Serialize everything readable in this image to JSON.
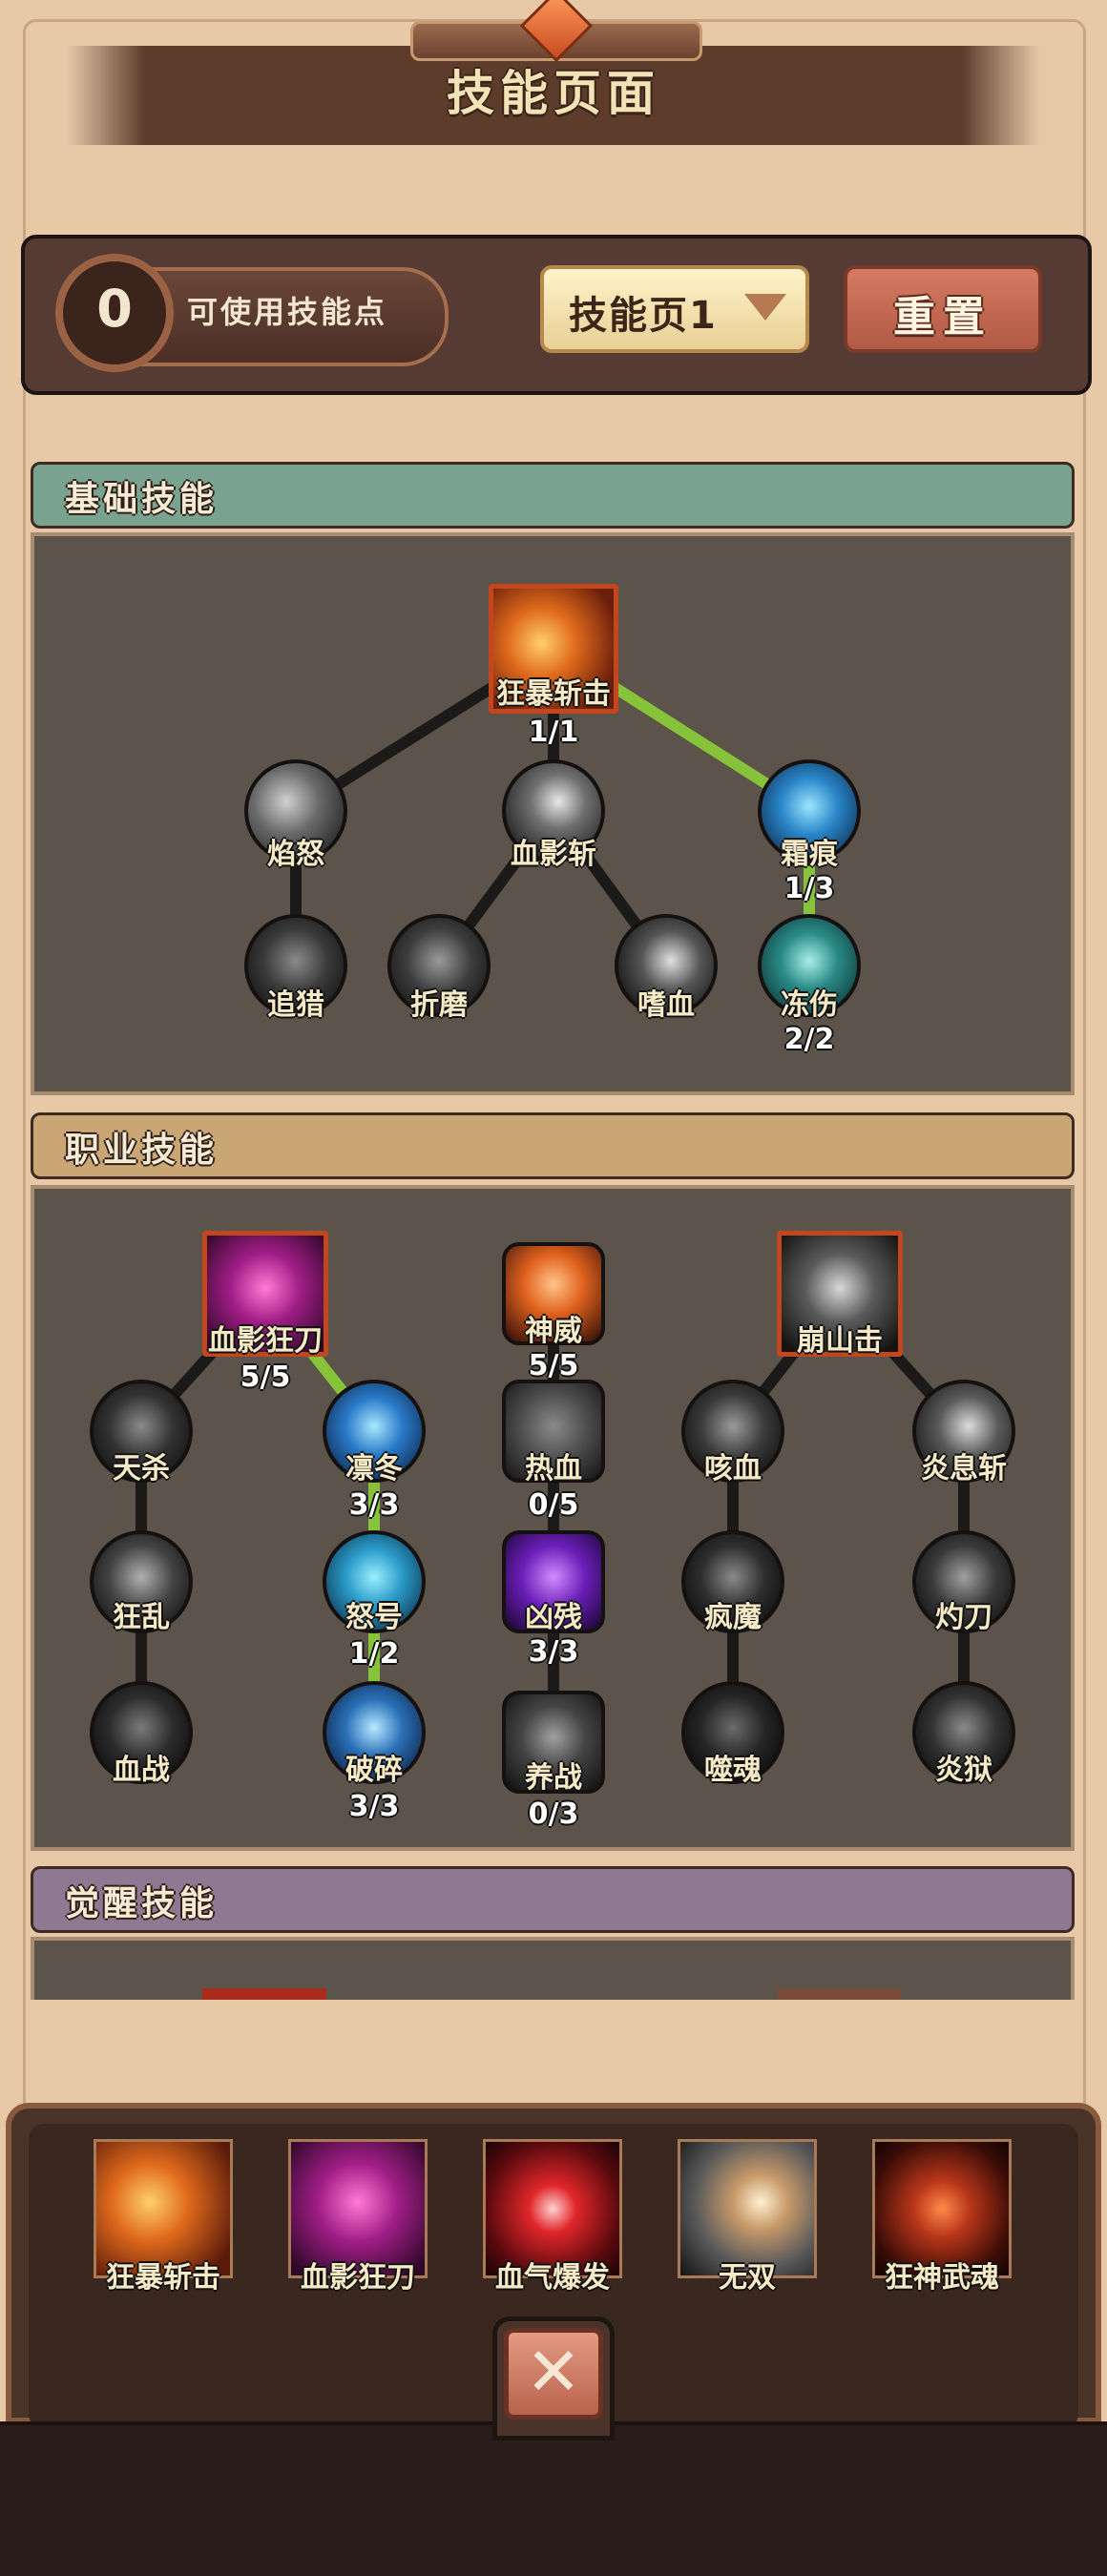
{
  "header": {
    "title": "技能页面"
  },
  "toolbar": {
    "skill_points": "0",
    "skill_points_label": "可使用技能点",
    "page_selector": "技能页1",
    "reset_label": "重置"
  },
  "sections": {
    "basic": {
      "title": "基础技能"
    },
    "class": {
      "title": "职业技能"
    },
    "awaken": {
      "title": "觉醒技能"
    }
  },
  "basic_skills": {
    "kuangbao": {
      "name": "狂暴斩击",
      "level": "1/1",
      "icon": "axe-slash-icon"
    },
    "yannu": {
      "name": "焰怒",
      "icon": "claw-swipe-icon"
    },
    "xueying": {
      "name": "血影斩",
      "icon": "blade-icon"
    },
    "shuanghen": {
      "name": "霜痕",
      "level": "1/3",
      "icon": "frost-crack-icon"
    },
    "zhuilie": {
      "name": "追猎",
      "icon": "hand-grab-icon"
    },
    "zhemo": {
      "name": "折磨",
      "icon": "spike-icon"
    },
    "shixue": {
      "name": "嗜血",
      "icon": "crescent-blade-icon"
    },
    "dongshang": {
      "name": "冻伤",
      "level": "2/2",
      "icon": "ice-hammer-icon"
    }
  },
  "class_skills": {
    "xueyingkuangdao": {
      "name": "血影狂刀",
      "level": "5/5",
      "icon": "crossed-blades-icon"
    },
    "shenwei": {
      "name": "神威",
      "level": "5/5",
      "icon": "raised-fist-icon"
    },
    "bengshanji": {
      "name": "崩山击",
      "icon": "mountain-strike-icon"
    },
    "tiansha": {
      "name": "天杀",
      "icon": "dark-slash-icon"
    },
    "lindong": {
      "name": "凛冬",
      "level": "3/3",
      "icon": "ice-shard-icon"
    },
    "rexue": {
      "name": "热血",
      "level": "0/5",
      "icon": "plus-icon"
    },
    "kexue": {
      "name": "咳血",
      "icon": "spiral-icon"
    },
    "yanxizhan": {
      "name": "炎息斩",
      "icon": "arc-slash-icon"
    },
    "kuangluan": {
      "name": "狂乱",
      "icon": "berserker-icon"
    },
    "nuhao": {
      "name": "怒号",
      "level": "1/2",
      "icon": "roaring-skull-icon"
    },
    "xiongcan": {
      "name": "凶残",
      "level": "3/3",
      "icon": "purple-claw-icon"
    },
    "fengmo": {
      "name": "疯魔",
      "icon": "demon-face-icon"
    },
    "zhuodao": {
      "name": "灼刀",
      "icon": "burning-sword-icon"
    },
    "xuezhan": {
      "name": "血战",
      "icon": "spear-icon"
    },
    "posui": {
      "name": "破碎",
      "level": "3/3",
      "icon": "shatter-icon"
    },
    "yangzhan": {
      "name": "养战",
      "level": "0/3",
      "icon": "beast-head-icon"
    },
    "shihun": {
      "name": "噬魂",
      "icon": "soul-hand-icon"
    },
    "yanyu": {
      "name": "炎狱",
      "icon": "hooded-skull-icon"
    }
  },
  "equipped": [
    {
      "name": "狂暴斩击",
      "icon": "axe-slash-icon"
    },
    {
      "name": "血影狂刀",
      "icon": "crossed-blades-icon"
    },
    {
      "name": "血气爆发",
      "icon": "blood-burst-icon"
    },
    {
      "name": "无双",
      "icon": "shield-slash-icon"
    },
    {
      "name": "狂神武魂",
      "icon": "demon-helm-icon"
    }
  ],
  "colors": {
    "basic_header": "#7aa290",
    "class_header": "#c9a674",
    "awaken_header": "#8e7892",
    "active_link": "#86c23a",
    "inactive_link": "#1c1a18",
    "square_border": "#c2471f"
  }
}
